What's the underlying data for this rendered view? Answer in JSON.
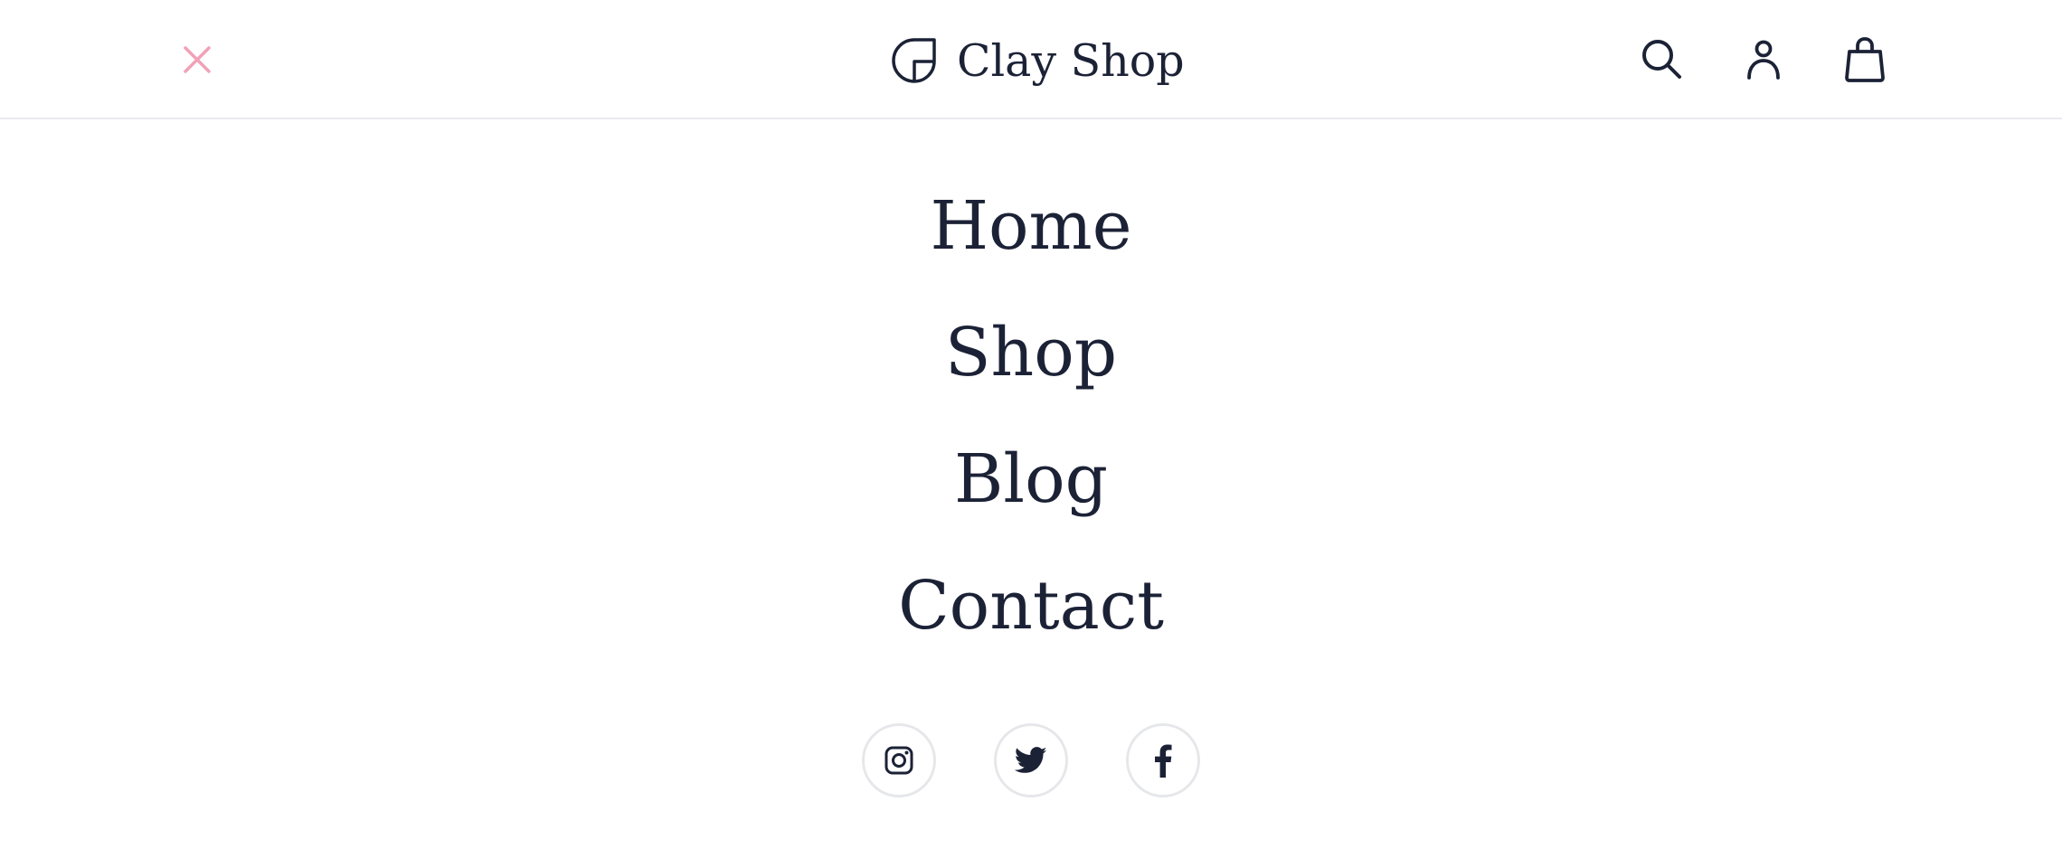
{
  "header": {
    "close_icon": "close-icon",
    "brand": {
      "logo_icon": "brand-logo-icon",
      "name": "Clay Shop"
    },
    "actions": [
      {
        "icon": "search-icon"
      },
      {
        "icon": "user-icon"
      },
      {
        "icon": "shopping-bag-icon"
      }
    ]
  },
  "nav": {
    "items": [
      {
        "label": "Home"
      },
      {
        "label": "Shop"
      },
      {
        "label": "Blog"
      },
      {
        "label": "Contact"
      }
    ]
  },
  "social": [
    {
      "icon": "instagram-icon"
    },
    {
      "icon": "twitter-icon"
    },
    {
      "icon": "facebook-icon"
    }
  ],
  "colors": {
    "text": "#1c2236",
    "accent_close": "#f2a1b7",
    "divider": "#e9eaee",
    "social_border": "#e6e7ea",
    "background": "#ffffff"
  }
}
